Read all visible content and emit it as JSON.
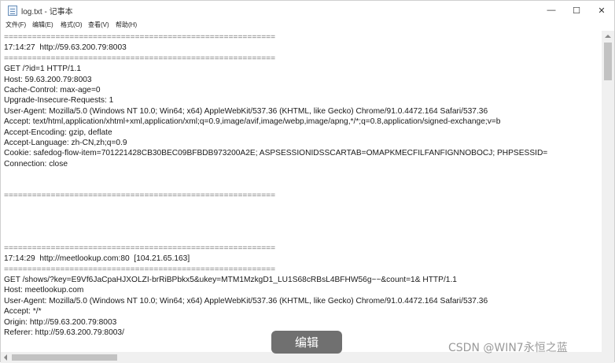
{
  "window": {
    "title": "log.txt - 记事本",
    "minimize_glyph": "—",
    "maximize_glyph": "☐",
    "close_glyph": "✕"
  },
  "menu": {
    "items": [
      "文件(F)",
      "编辑(E)",
      "格式(O)",
      "查看(V)",
      "帮助(H)"
    ]
  },
  "icons": {
    "app": "notepad-icon"
  },
  "content": {
    "lines": [
      "==========================================================",
      "17:14:27  http://59.63.200.79:8003",
      "==========================================================",
      "GET /?id=1 HTTP/1.1",
      "Host: 59.63.200.79:8003",
      "Cache-Control: max-age=0",
      "Upgrade-Insecure-Requests: 1",
      "User-Agent: Mozilla/5.0 (Windows NT 10.0; Win64; x64) AppleWebKit/537.36 (KHTML, like Gecko) Chrome/91.0.4472.164 Safari/537.36",
      "Accept: text/html,application/xhtml+xml,application/xml;q=0.9,image/avif,image/webp,image/apng,*/*;q=0.8,application/signed-exchange;v=b",
      "Accept-Encoding: gzip, deflate",
      "Accept-Language: zh-CN,zh;q=0.9",
      "Cookie: safedog-flow-item=701221428CB30BEC09BFBDB973200A2E; ASPSESSIONIDSSCARTAB=OMAPKMECFILFANFIGNNOBOCJ; PHPSESSID=",
      "Connection: close",
      "",
      "",
      "==========================================================",
      "",
      "",
      "",
      "",
      "==========================================================",
      "17:14:29  http://meetlookup.com:80  [104.21.65.163]",
      "==========================================================",
      "GET /shows/?key=E9Vf6JaCpaHJXOLZI-brRiBPbkx5&ukey=MTM1MzkgD1_LU1S68cRBsL4BFHW56g~~&count=1& HTTP/1.1",
      "Host: meetlookup.com",
      "User-Agent: Mozilla/5.0 (Windows NT 10.0; Win64; x64) AppleWebKit/537.36 (KHTML, like Gecko) Chrome/91.0.4472.164 Safari/537.36",
      "Accept: */*",
      "Origin: http://59.63.200.79:8003",
      "Referer: http://59.63.200.79:8003/"
    ]
  },
  "overlay": {
    "edit_label": "编辑",
    "watermark": "CSDN @WIN7永恒之蓝"
  }
}
